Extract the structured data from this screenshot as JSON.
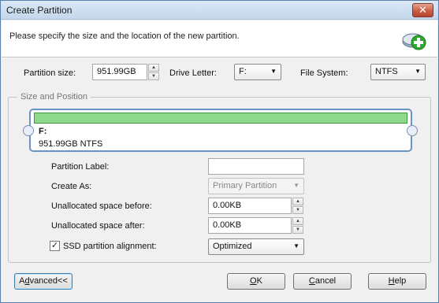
{
  "window": {
    "title": "Create Partition",
    "close_glyph": "✕"
  },
  "header": {
    "description": "Please specify the size and the location of the new partition.",
    "logo_icon": "add-partition-icon"
  },
  "top_row": {
    "partition_size_label": "Partition size:",
    "partition_size_value": "951.99GB",
    "drive_letter_label": "Drive Letter:",
    "drive_letter_value": "F:",
    "file_system_label": "File System:",
    "file_system_value": "NTFS"
  },
  "size_position": {
    "group_title": "Size and Position",
    "partition_name": "F:",
    "partition_info": "951.99GB NTFS",
    "bar_fill_fraction": 1.0
  },
  "form": {
    "partition_label_label": "Partition Label:",
    "partition_label_value": "",
    "create_as_label": "Create As:",
    "create_as_value": "Primary Partition",
    "unalloc_before_label": "Unallocated space before:",
    "unalloc_before_value": "0.00KB",
    "unalloc_after_label": "Unallocated space after:",
    "unalloc_after_value": "0.00KB",
    "ssd_label": "SSD partition alignment:",
    "ssd_checked": true,
    "ssd_value": "Optimized"
  },
  "buttons": {
    "advanced_prefix": "A",
    "advanced_accel": "d",
    "advanced_suffix": "vanced<<",
    "ok_accel": "O",
    "ok_suffix": "K",
    "cancel_accel": "C",
    "cancel_suffix": "ancel",
    "help_accel": "H",
    "help_suffix": "elp"
  },
  "colors": {
    "accent": "#6b92c4",
    "partition_fill": "#8fd98f",
    "title_bar": "#c4d7ec"
  }
}
